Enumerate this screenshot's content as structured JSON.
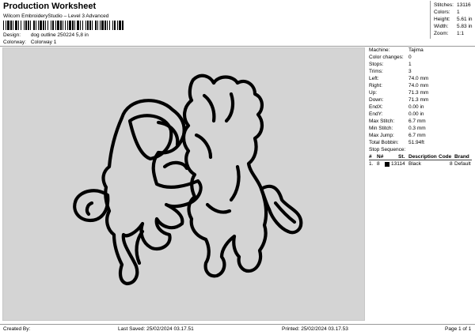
{
  "header": {
    "title": "Production Worksheet",
    "subtitle": "Wilcom EmbroideryStudio – Level 3 Advanced",
    "barcode_suffix": ","
  },
  "info": {
    "design_label": "Design:",
    "design_value": "dog outline 250224 5,8 in",
    "colorway_label": "Colorway:",
    "colorway_value": "Colorway 1"
  },
  "stats": {
    "stitches_label": "Stitches:",
    "stitches_value": "13116",
    "colors_label": "Colors:",
    "colors_value": "1",
    "height_label": "Height:",
    "height_value": "5.61 in",
    "width_label": "Width:",
    "width_value": "5.83 in",
    "zoom_label": "Zoom:",
    "zoom_value": "1:1"
  },
  "machine": {
    "machine_label": "Machine:",
    "machine_value": "Tajima",
    "color_changes_label": "Color changes:",
    "color_changes_value": "0",
    "stops_label": "Stops:",
    "stops_value": "1",
    "trims_label": "Trims:",
    "trims_value": "3",
    "left_label": "Left:",
    "left_value": "74.0 mm",
    "right_label": "Right:",
    "right_value": "74.0 mm",
    "up_label": "Up:",
    "up_value": "71.3 mm",
    "down_label": "Down:",
    "down_value": "71.3 mm",
    "endx_label": "EndX:",
    "endx_value": "0.00 in",
    "endy_label": "EndY:",
    "endy_value": "0.00 in",
    "max_stitch_label": "Max Stitch:",
    "max_stitch_value": "6.7 mm",
    "min_stitch_label": "Min Stitch:",
    "min_stitch_value": "0.3 mm",
    "max_jump_label": "Max Jump:",
    "max_jump_value": "6.7 mm",
    "total_bobbin_label": "Total Bobbin:",
    "total_bobbin_value": "51.94ft"
  },
  "sequence": {
    "title": "Stop Sequence:",
    "headers": {
      "num": "#",
      "n": "N#",
      "st": "St.",
      "description": "Description",
      "code": "Code",
      "brand": "Brand"
    },
    "rows": [
      {
        "num": "1.",
        "n": "8",
        "swatch": "#000000",
        "st": "13114",
        "description": "Black",
        "code": "8",
        "brand": "Default"
      }
    ]
  },
  "footer": {
    "created_by": "Created By:",
    "last_saved": "Last Saved: 25/02/2024 03.17.51",
    "printed": "Printed: 25/02/2024 03.17.53",
    "page": "Page 1 of 1"
  }
}
